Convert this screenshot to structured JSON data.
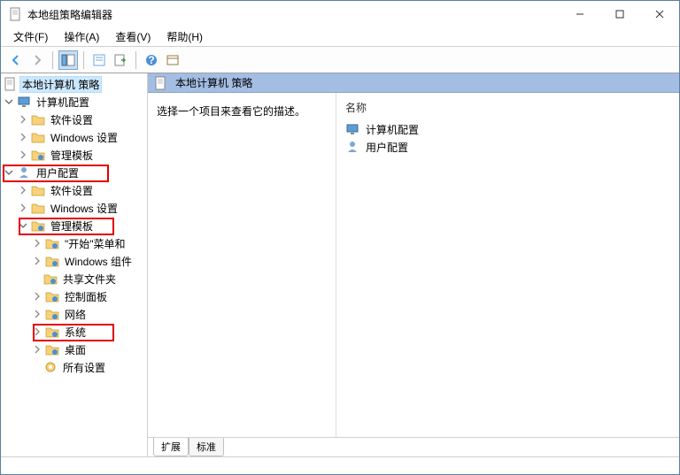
{
  "window": {
    "title": "本地组策略编辑器"
  },
  "menu": {
    "file": "文件(F)",
    "action": "操作(A)",
    "view": "查看(V)",
    "help": "帮助(H)"
  },
  "tree": {
    "root": "本地计算机 策略",
    "computer": "计算机配置",
    "software1": "软件设置",
    "windows1": "Windows 设置",
    "admin1": "管理模板",
    "user": "用户配置",
    "software2": "软件设置",
    "windows2": "Windows 设置",
    "admin2": "管理模板",
    "startmenu": "\"开始\"菜单和",
    "winComp": "Windows 组件",
    "shared": "共享文件夹",
    "control": "控制面板",
    "network": "网络",
    "system": "系统",
    "desktop": "桌面",
    "allsettings": "所有设置"
  },
  "right": {
    "header": "本地计算机 策略",
    "desc": "选择一个项目来查看它的描述。",
    "colName": "名称",
    "item1": "计算机配置",
    "item2": "用户配置"
  },
  "tabs": {
    "ext": "扩展",
    "std": "标准"
  }
}
